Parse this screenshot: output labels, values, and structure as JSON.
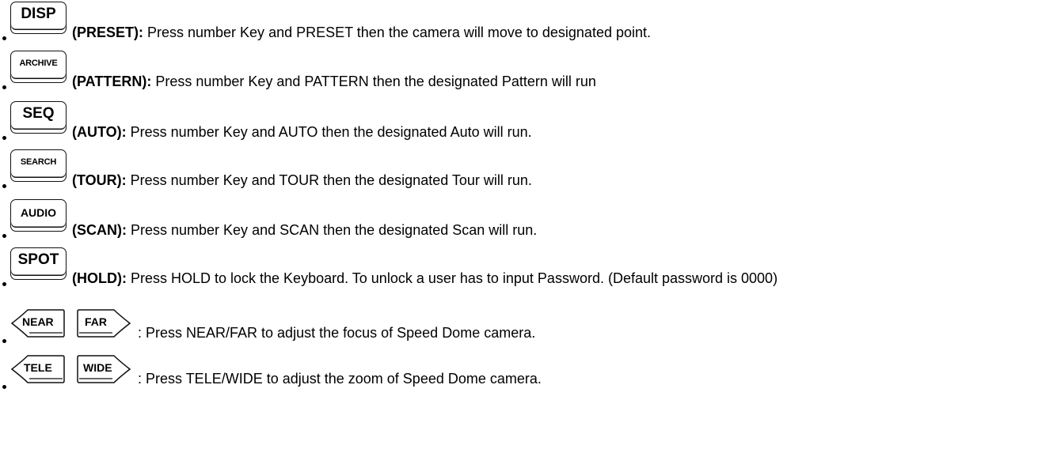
{
  "items": [
    {
      "key": "DISP",
      "name": "(PRESET):",
      "desc": " Press number Key and PRESET then the camera will move to designated point."
    },
    {
      "key": "ARCHIVE",
      "name": "(PATTERN):",
      "desc": " Press number Key and PATTERN then the designated Pattern will run"
    },
    {
      "key": "SEQ",
      "name": "(AUTO):",
      "desc": " Press number Key and AUTO then the designated Auto will run."
    },
    {
      "key": "SEARCH",
      "name": "(TOUR):",
      "desc": " Press number Key and TOUR then the designated Tour will run."
    },
    {
      "key": "AUDIO",
      "name": "(SCAN):",
      "desc": " Press number Key and SCAN then the designated Scan will run."
    },
    {
      "key": "SPOT",
      "name": "(HOLD):",
      "desc": " Press HOLD to lock the Keyboard. To unlock a user has to input Password. (Default password is 0000)"
    }
  ],
  "pairs": [
    {
      "left_key": "NEAR",
      "right_key": "FAR",
      "desc": ": Press NEAR/FAR to adjust the focus of Speed Dome camera."
    },
    {
      "left_key": "TELE",
      "right_key": "WIDE",
      "desc": ": Press TELE/WIDE to adjust the zoom of Speed Dome camera."
    }
  ]
}
